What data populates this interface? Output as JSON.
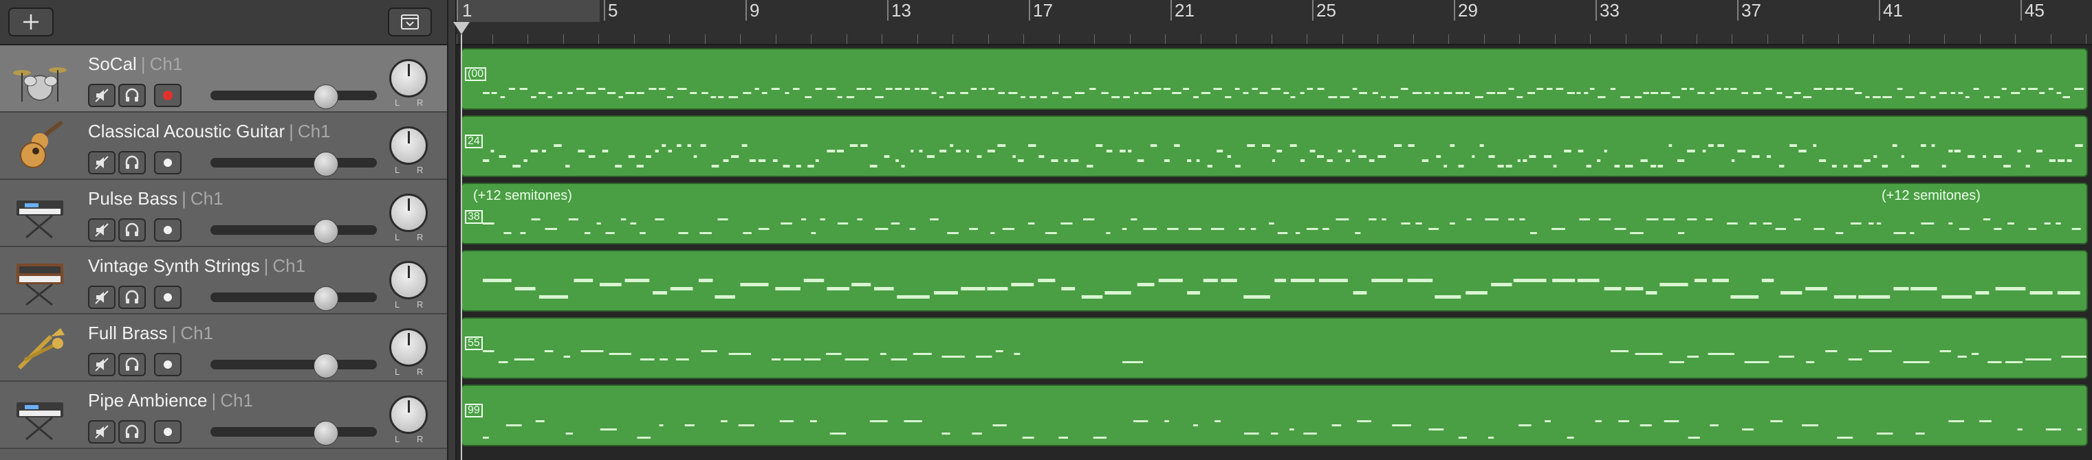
{
  "header": {
    "add_button_icon": "plus-icon",
    "menu_button_icon": "chevron-down-box-icon"
  },
  "ruler": {
    "bars": [
      "1",
      "5",
      "9",
      "13",
      "17",
      "21",
      "25",
      "29",
      "33",
      "37",
      "41",
      "45"
    ]
  },
  "tracks": [
    {
      "name": "SoCal",
      "channel": "Ch1",
      "separator": "|",
      "instrument_icon": "drum-kit-icon",
      "selected": true,
      "record_armed": true,
      "region_label": "(00"
    },
    {
      "name": "Classical Acoustic Guitar",
      "channel": "Ch1",
      "separator": "|",
      "instrument_icon": "acoustic-guitar-icon",
      "selected": false,
      "record_armed": false,
      "region_label": "24"
    },
    {
      "name": "Pulse Bass",
      "channel": "Ch1",
      "separator": "|",
      "instrument_icon": "keyboard-icon",
      "selected": false,
      "record_armed": false,
      "region_label": "38",
      "region_annotations": [
        "(+12 semitones)",
        "(+12 semitones)"
      ]
    },
    {
      "name": "Vintage Synth Strings",
      "channel": "Ch1",
      "separator": "|",
      "instrument_icon": "synthesizer-icon",
      "selected": false,
      "record_armed": false,
      "region_label": ""
    },
    {
      "name": "Full Brass",
      "channel": "Ch1",
      "separator": "|",
      "instrument_icon": "brass-icon",
      "selected": false,
      "record_armed": false,
      "region_label": "55"
    },
    {
      "name": "Pipe Ambience",
      "channel": "Ch1",
      "separator": "|",
      "instrument_icon": "keyboard-icon",
      "selected": false,
      "record_armed": false,
      "region_label": "99"
    }
  ],
  "pan": {
    "left_label": "L",
    "right_label": "R"
  },
  "colors": {
    "region_fill": "#4a9e43",
    "note_color": "#d9f5d2",
    "record_red": "#e0322b"
  }
}
